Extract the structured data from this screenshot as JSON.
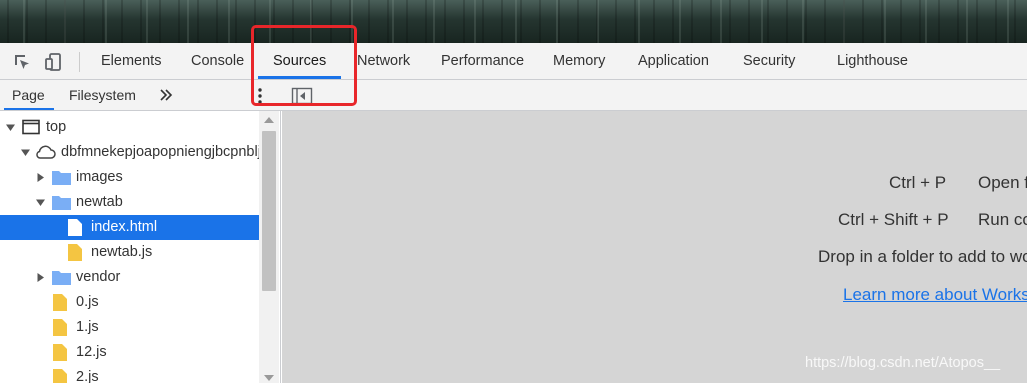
{
  "top_tabs": [
    {
      "label": "Elements"
    },
    {
      "label": "Console"
    },
    {
      "label": "Sources",
      "active": true
    },
    {
      "label": "Network"
    },
    {
      "label": "Performance"
    },
    {
      "label": "Memory"
    },
    {
      "label": "Application"
    },
    {
      "label": "Security"
    },
    {
      "label": "Lighthouse"
    }
  ],
  "tools": {
    "inspect_icon": "inspect-element-icon",
    "device_icon": "device-toolbar-icon"
  },
  "sub_tabs": [
    {
      "label": "Page",
      "active": true
    },
    {
      "label": "Filesystem"
    }
  ],
  "sub_more": "»",
  "tree": [
    {
      "label": "top",
      "icon": "frame-icon",
      "expanded": true
    },
    {
      "label": "dbfmnekepjoapopniengjbcpnbljalfkhp",
      "icon": "cloud-icon",
      "expanded": true
    },
    {
      "label": "images",
      "icon": "folder-icon",
      "expanded": false
    },
    {
      "label": "newtab",
      "icon": "folder-icon",
      "expanded": true
    },
    {
      "label": "index.html",
      "icon": "document-icon",
      "selected": true
    },
    {
      "label": "newtab.js",
      "icon": "script-file-icon"
    },
    {
      "label": "vendor",
      "icon": "folder-icon",
      "expanded": false
    },
    {
      "label": "0.js",
      "icon": "script-file-icon"
    },
    {
      "label": "1.js",
      "icon": "script-file-icon"
    },
    {
      "label": "12.js",
      "icon": "script-file-icon"
    },
    {
      "label": "2.js",
      "icon": "script-file-icon"
    }
  ],
  "editor": {
    "shortcuts": [
      {
        "keys": "Ctrl + P",
        "action": "Open file"
      },
      {
        "keys": "Ctrl + Shift + P",
        "action": "Run command"
      }
    ],
    "drop_text": "Drop in a folder to add to workspace",
    "learn_more": "Learn more about Workspaces"
  },
  "watermark": "https://blog.csdn.net/Atopos__",
  "colors": {
    "accent": "#1a73e8",
    "highlight": "#e8262a",
    "folder": "#7aaef5",
    "script": "#f4c542"
  }
}
